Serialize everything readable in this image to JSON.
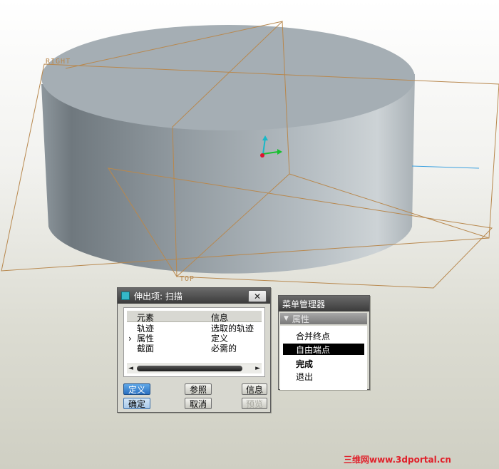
{
  "viewport": {
    "label_right": "RIGHT",
    "label_top": "TOP",
    "colors": {
      "datum": "#b8884e",
      "cylinder": "#a7b0b6",
      "axis_x": "#18c030",
      "axis_y": "#18b8c8",
      "origin": "#e01030"
    }
  },
  "dialog": {
    "title": "伸出项: 扫描",
    "close_icon": "close-icon",
    "columns": [
      "元素",
      "信息"
    ],
    "rows": [
      {
        "marker": "",
        "element": "轨迹",
        "info": "选取的轨迹"
      },
      {
        "marker": "›",
        "element": "属性",
        "info": "定义"
      },
      {
        "marker": "",
        "element": "截面",
        "info": "必需的"
      }
    ],
    "scroll_left": "◄",
    "scroll_right": "►",
    "buttons": {
      "define": "定义",
      "refs": "参照",
      "info": "信息",
      "ok": "确定",
      "cancel": "取消",
      "preview": "预览"
    }
  },
  "menu": {
    "title": "菜单管理器",
    "section": "属性",
    "items": [
      "合并终点",
      "自由端点",
      "完成",
      "退出"
    ]
  },
  "watermark": "三维网www.3dportal.cn"
}
